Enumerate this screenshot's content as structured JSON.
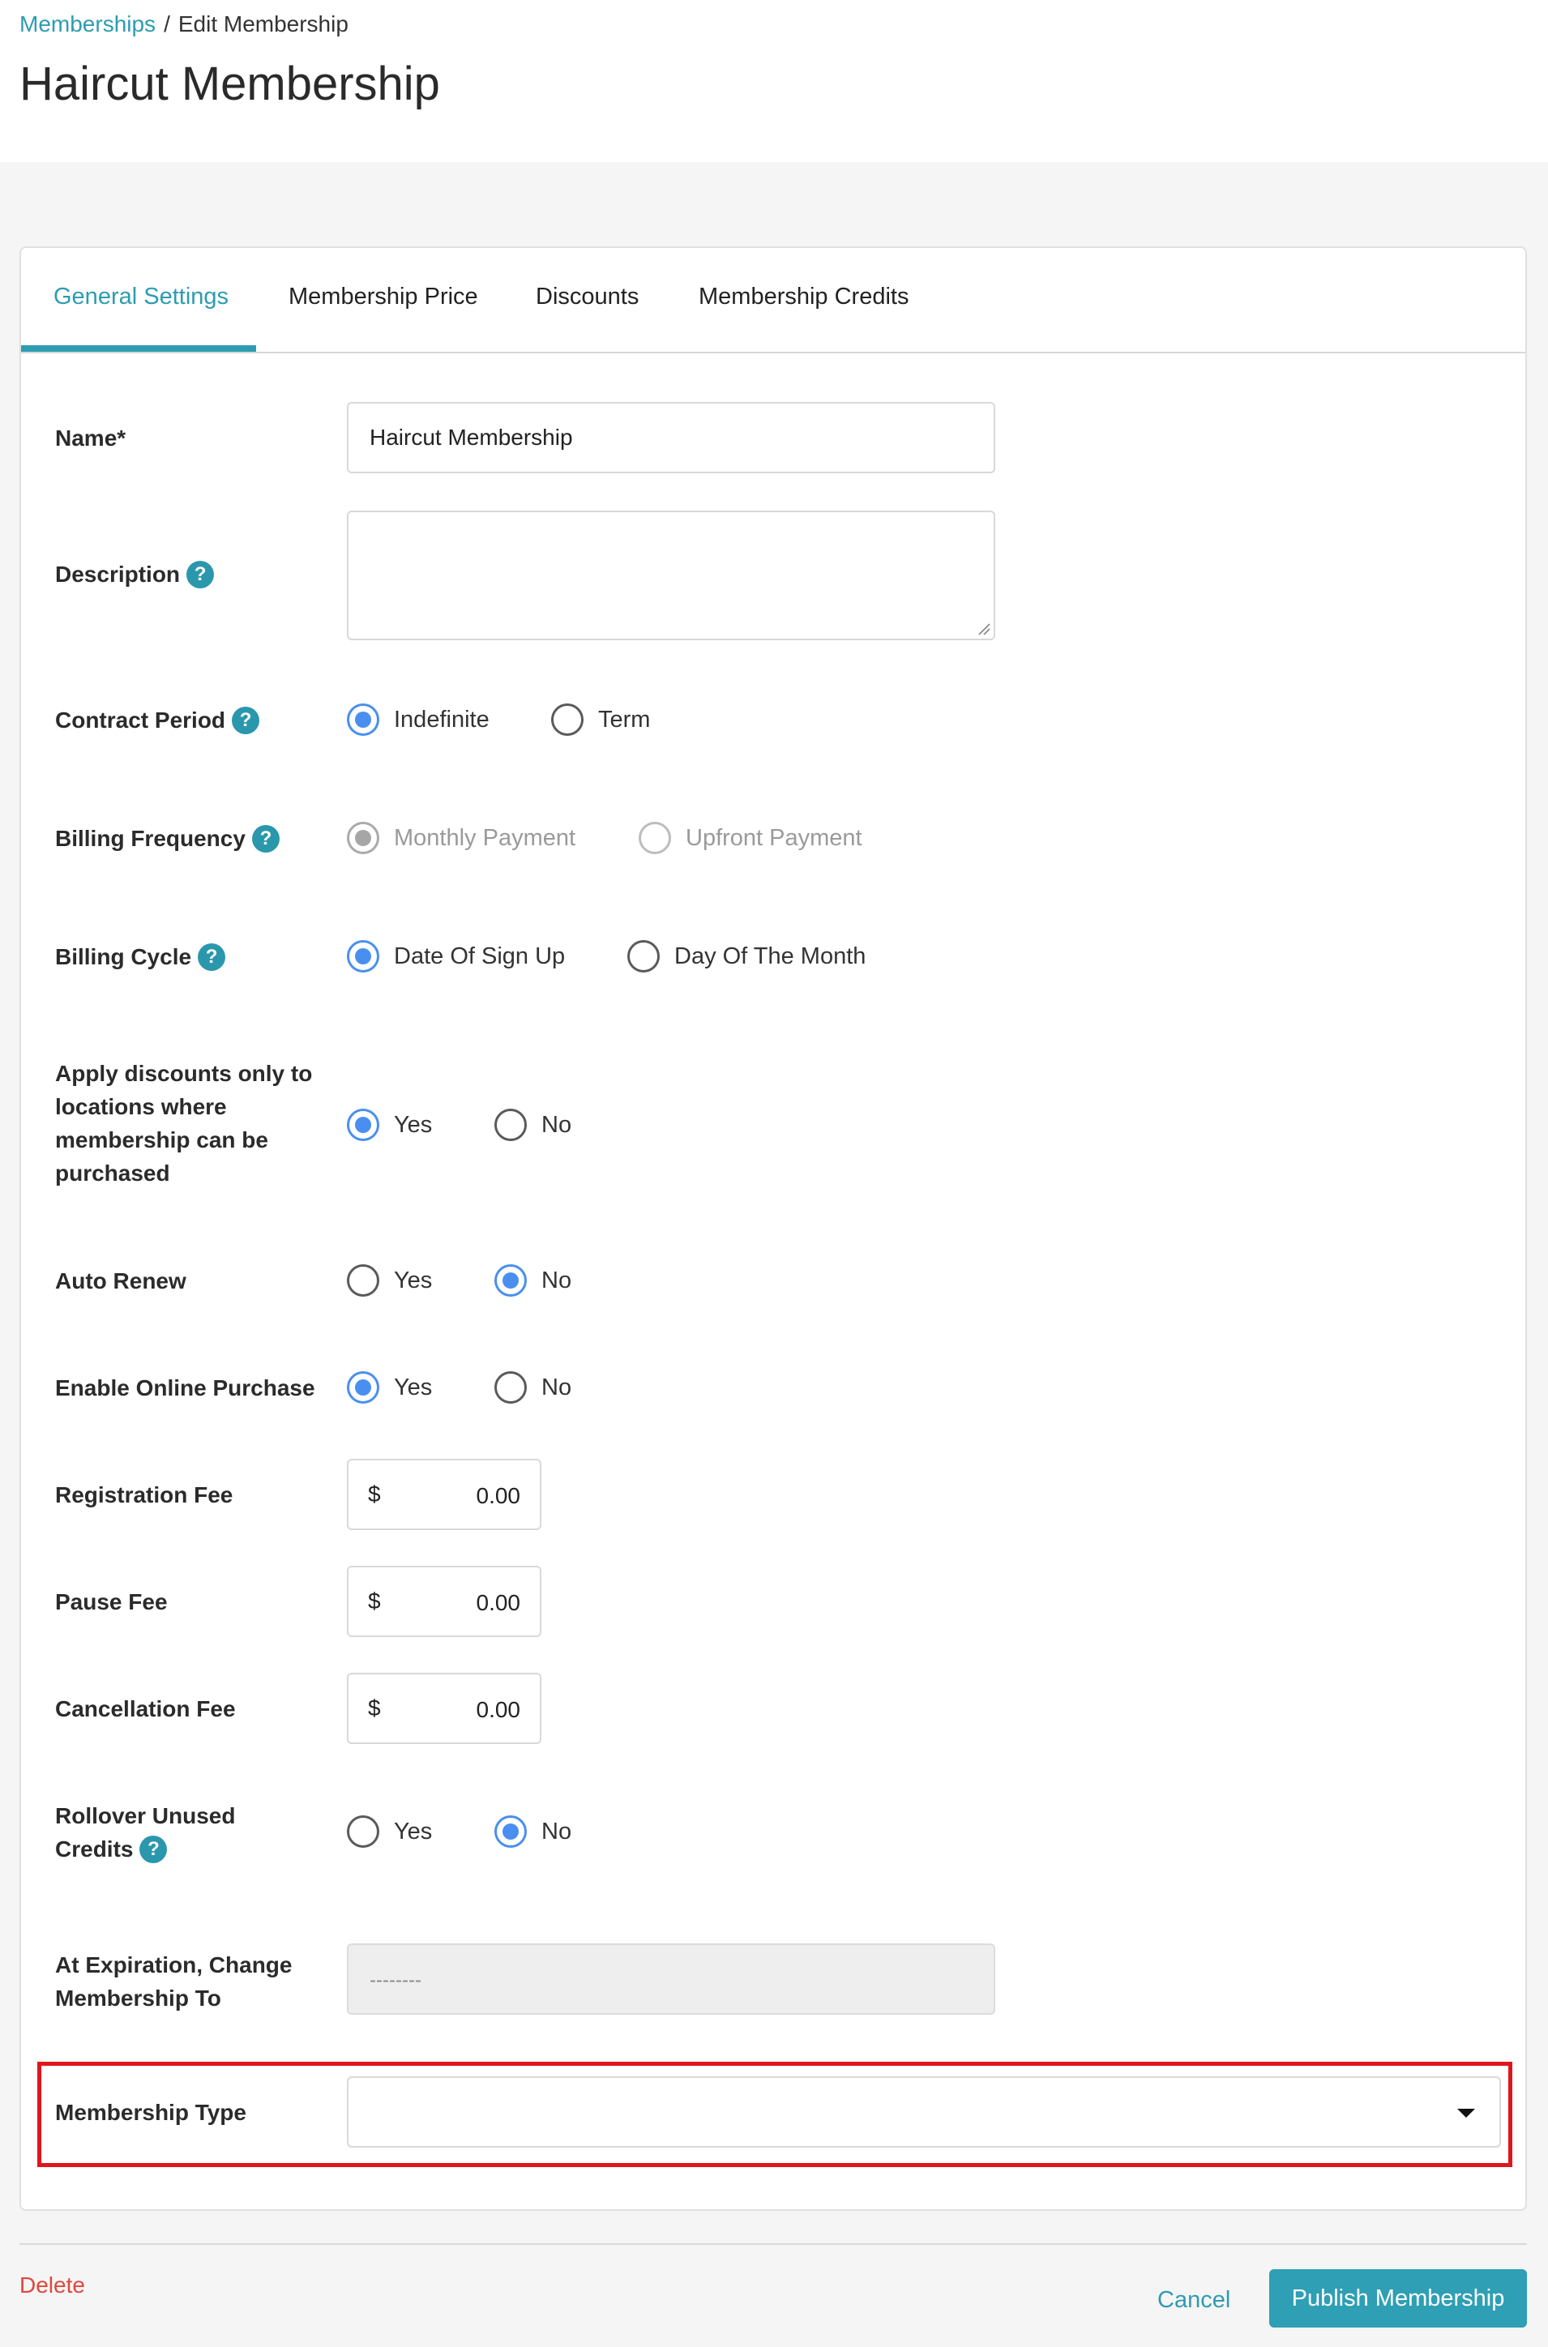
{
  "breadcrumb": {
    "parent": "Memberships",
    "separator": "/",
    "current": "Edit Membership"
  },
  "page_title": "Haircut Membership",
  "tabs": [
    {
      "label": "General Settings",
      "active": true
    },
    {
      "label": "Membership Price",
      "active": false
    },
    {
      "label": "Discounts",
      "active": false
    },
    {
      "label": "Membership Credits",
      "active": false
    }
  ],
  "form": {
    "name": {
      "label": "Name*",
      "value": "Haircut Membership"
    },
    "description": {
      "label": "Description",
      "value": ""
    },
    "contract_period": {
      "label": "Contract Period",
      "options": [
        "Indefinite",
        "Term"
      ],
      "selected": "Indefinite"
    },
    "billing_frequency": {
      "label": "Billing Frequency",
      "options": [
        "Monthly Payment",
        "Upfront Payment"
      ],
      "selected": "Monthly Payment",
      "disabled": true
    },
    "billing_cycle": {
      "label": "Billing Cycle",
      "options": [
        "Date Of Sign Up",
        "Day Of The Month"
      ],
      "selected": "Date Of Sign Up"
    },
    "apply_discounts": {
      "label_lines": [
        "Apply discounts only to",
        "locations where",
        "membership can be",
        "purchased"
      ],
      "options": [
        "Yes",
        "No"
      ],
      "selected": "Yes"
    },
    "auto_renew": {
      "label": "Auto Renew",
      "options": [
        "Yes",
        "No"
      ],
      "selected": "No"
    },
    "online_purchase": {
      "label": "Enable Online Purchase",
      "options": [
        "Yes",
        "No"
      ],
      "selected": "Yes"
    },
    "registration_fee": {
      "label": "Registration Fee",
      "currency": "$",
      "value": "0.00"
    },
    "pause_fee": {
      "label": "Pause Fee",
      "currency": "$",
      "value": "0.00"
    },
    "cancellation_fee": {
      "label": "Cancellation Fee",
      "currency": "$",
      "value": "0.00"
    },
    "rollover_credits": {
      "label_lines": [
        "Rollover Unused",
        "Credits"
      ],
      "options": [
        "Yes",
        "No"
      ],
      "selected": "No"
    },
    "expiration_change": {
      "label_lines": [
        "At Expiration, Change",
        "Membership To"
      ],
      "value": "--------"
    },
    "membership_type": {
      "label": "Membership Type",
      "value": ""
    }
  },
  "help_icon_text": "?",
  "footer": {
    "delete_label": "Delete",
    "cancel_label": "Cancel",
    "publish_label": "Publish Membership"
  },
  "colors": {
    "accent": "#2c9cb1",
    "radio_checked": "#4a8ff0",
    "highlight": "#e0161d",
    "danger": "#e0473d"
  }
}
